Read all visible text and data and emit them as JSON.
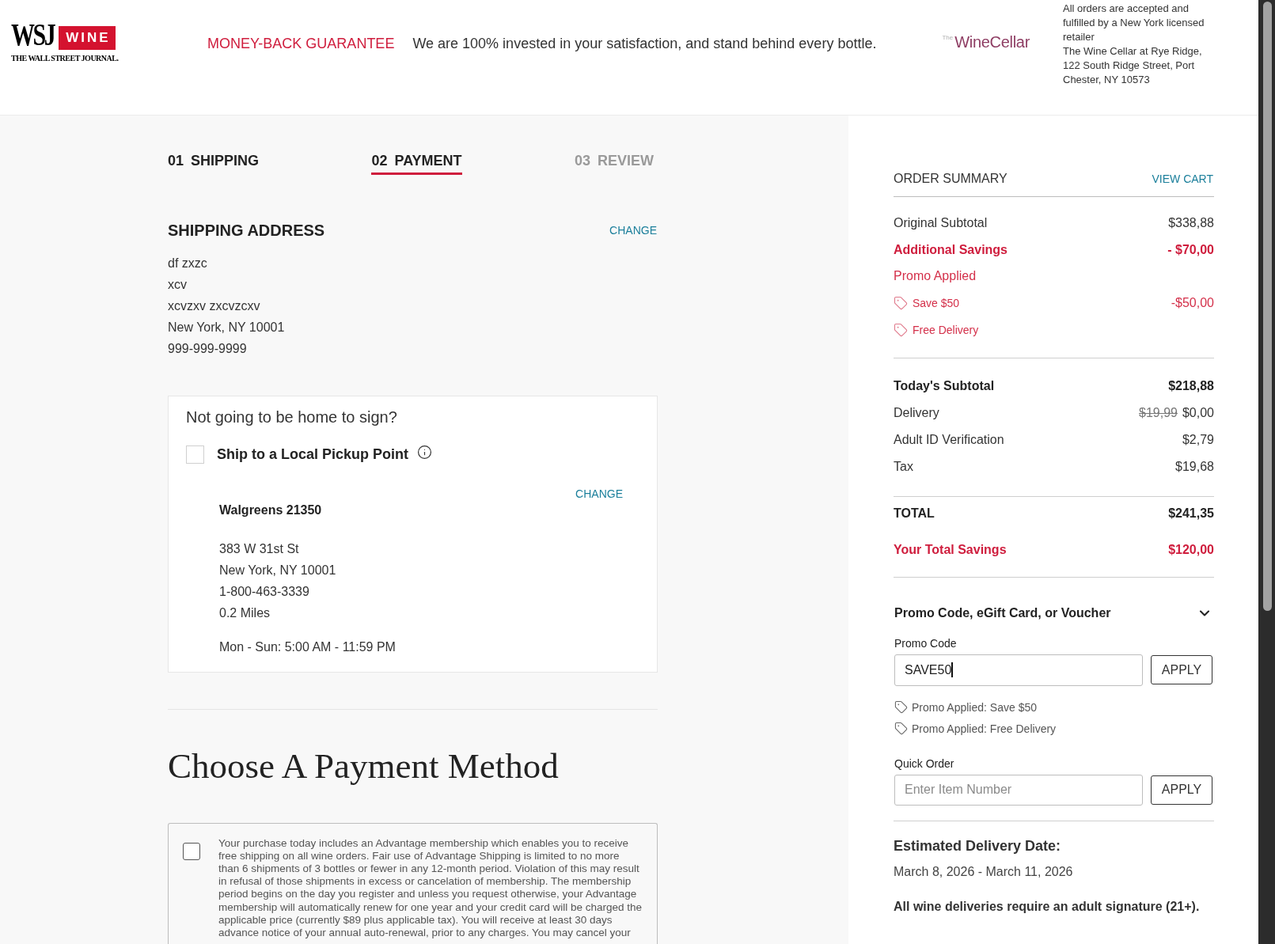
{
  "header": {
    "logo": {
      "wordmark": "WSJ",
      "badge": "WINE",
      "tagline": "THE WALL STREET JOURNAL."
    },
    "guarantee": {
      "title": "MONEY-BACK GUARANTEE",
      "message": "We are 100% invested in your satisfaction, and stand behind every bottle."
    },
    "partner_logo": {
      "prefix": "The",
      "name": "WineCellar"
    },
    "licensing_note": [
      "All orders are accepted and fulfilled by a New York licensed retailer",
      "The Wine Cellar at Rye Ridge, 122 South Ridge Street, Port Chester, NY 10573"
    ]
  },
  "steps": [
    {
      "number": "01",
      "label": "SHIPPING",
      "selected": false,
      "disabled": false
    },
    {
      "number": "02",
      "label": "PAYMENT",
      "selected": true,
      "disabled": false
    },
    {
      "number": "03",
      "label": "REVIEW",
      "selected": false,
      "disabled": true
    }
  ],
  "shipping_address": {
    "title": "SHIPPING ADDRESS",
    "action": "CHANGE",
    "lines": [
      "df zxzc",
      "xcv",
      "xcvzxv zxcvzcxv",
      "New York, NY 10001",
      "999-999-9999"
    ]
  },
  "pickup": {
    "question": "Not going to be home to sign?",
    "option": {
      "label": "Ship to a Local Pickup Point",
      "checked": false
    },
    "action": "CHANGE",
    "location": {
      "name": "Walgreens 21350",
      "address_lines": [
        "383 W 31st St",
        "New York, NY 10001",
        "1-800-463-3339",
        "0.2 Miles"
      ],
      "hours": "Mon - Sun: 5:00 AM - 11:59 PM"
    }
  },
  "payment": {
    "title": "Choose A Payment Method",
    "membership": {
      "checked": false,
      "text": "Your purchase today includes an Advantage membership which enables you to receive free shipping on all wine orders. Fair use of Advantage Shipping is limited to no more than 6 shipments of 3 bottles or fewer in any 12-month period. Violation of this may result in refusal of those shipments in excess or cancelation of membership. The membership period begins on the day you register and unless you request otherwise, your Advantage membership will automatically renew for one year and your credit card will be charged the applicable price (currently $89 plus applicable tax). You will receive at least 30 days advance notice of your annual auto-renewal, prior to any charges. You may cancel your"
    }
  },
  "order_summary": {
    "title": "ORDER SUMMARY",
    "link": "VIEW CART",
    "adjustments": [
      {
        "kind": "plain",
        "label": "Original Subtotal",
        "value": "$338,88"
      },
      {
        "kind": "savings",
        "label": "Additional Savings",
        "value": "- $70,00"
      },
      {
        "kind": "promo_heading",
        "label": "Promo Applied"
      },
      {
        "kind": "promo",
        "label": "Save $50",
        "value": "-$50,00"
      },
      {
        "kind": "promo",
        "label": "Free Delivery"
      }
    ],
    "charges": [
      {
        "kind": "strong",
        "label": "Today's Subtotal",
        "value": "$218,88"
      },
      {
        "kind": "plain",
        "label": "Delivery",
        "old_value": "$19,99",
        "value": "$0,00"
      },
      {
        "kind": "plain",
        "label": "Adult ID Verification",
        "value": "$2,79"
      },
      {
        "kind": "plain",
        "label": "Tax",
        "value": "$19,68"
      }
    ],
    "totals": [
      {
        "kind": "strong",
        "label": "TOTAL",
        "value": "$241,35"
      },
      {
        "kind": "savings",
        "label": "Your Total Savings",
        "value": "$120,00"
      }
    ]
  },
  "promo": {
    "title": "Promo Code, eGift Card, or Voucher",
    "expanded": true,
    "promo_code": {
      "label": "Promo Code",
      "value": "SAVE50",
      "button": "APPLY"
    },
    "applied": [
      "Promo Applied: Save $50",
      "Promo Applied: Free Delivery"
    ]
  },
  "quick_order": {
    "label": "Quick Order",
    "placeholder": "Enter Item Number",
    "button": "APPLY"
  },
  "delivery": {
    "title": "Estimated Delivery Date:",
    "dates": "March 8, 2026 - March 11, 2026",
    "note": "All wine deliveries require an adult signature (21+)."
  }
}
